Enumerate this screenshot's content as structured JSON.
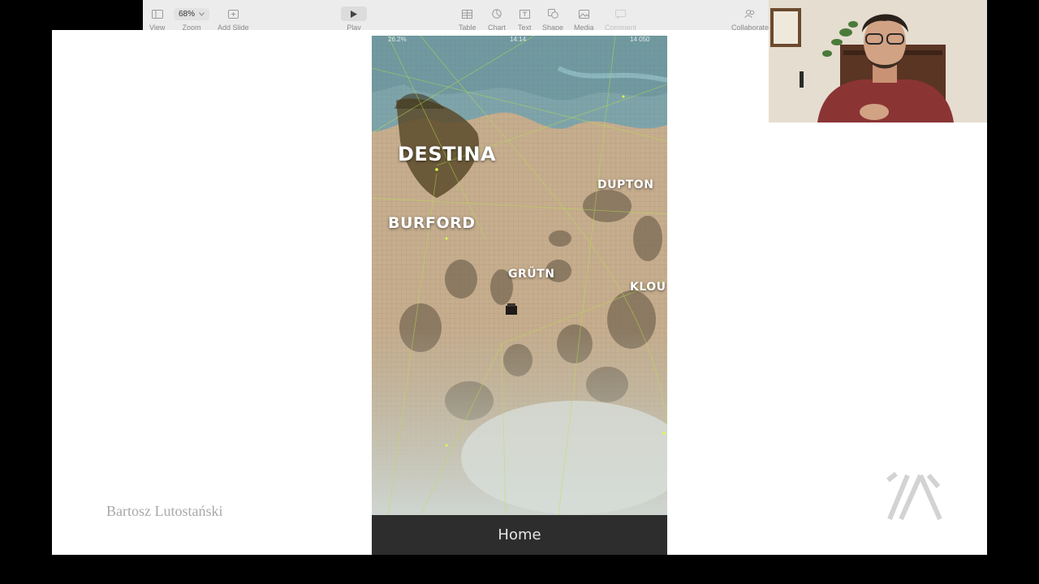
{
  "toolbar": {
    "items": [
      {
        "label": "View",
        "icon": "sidebar-icon"
      },
      {
        "label": "Zoom",
        "value": "68%",
        "icon": "chevron-down-icon"
      },
      {
        "label": "Add Slide",
        "icon": "add-slide-icon"
      },
      {
        "label": "Play",
        "icon": "play-icon"
      },
      {
        "label": "Table",
        "icon": "table-icon"
      },
      {
        "label": "Chart",
        "icon": "chart-icon"
      },
      {
        "label": "Text",
        "icon": "text-icon"
      },
      {
        "label": "Shape",
        "icon": "shape-icon"
      },
      {
        "label": "Media",
        "icon": "media-icon"
      },
      {
        "label": "Comment",
        "icon": "comment-icon",
        "enabled": false
      },
      {
        "label": "Collaborate",
        "icon": "collaborate-icon"
      }
    ]
  },
  "slide": {
    "author": "Bartosz Lutostański",
    "logo": "ia-logo"
  },
  "phone": {
    "status": {
      "left": "26.2%",
      "time": "14:14",
      "right": "14 050"
    },
    "map_labels": [
      "DESTINA",
      "DUPTON",
      "BURFORD",
      "GRÜTN",
      "KLOU"
    ],
    "nav_title": "Home"
  },
  "colors": {
    "toolbar_bg": "#ececec",
    "map_sand": "#c7ad8c",
    "map_water": "#7fa7ae",
    "navbar_bg": "#2d2d2d"
  }
}
